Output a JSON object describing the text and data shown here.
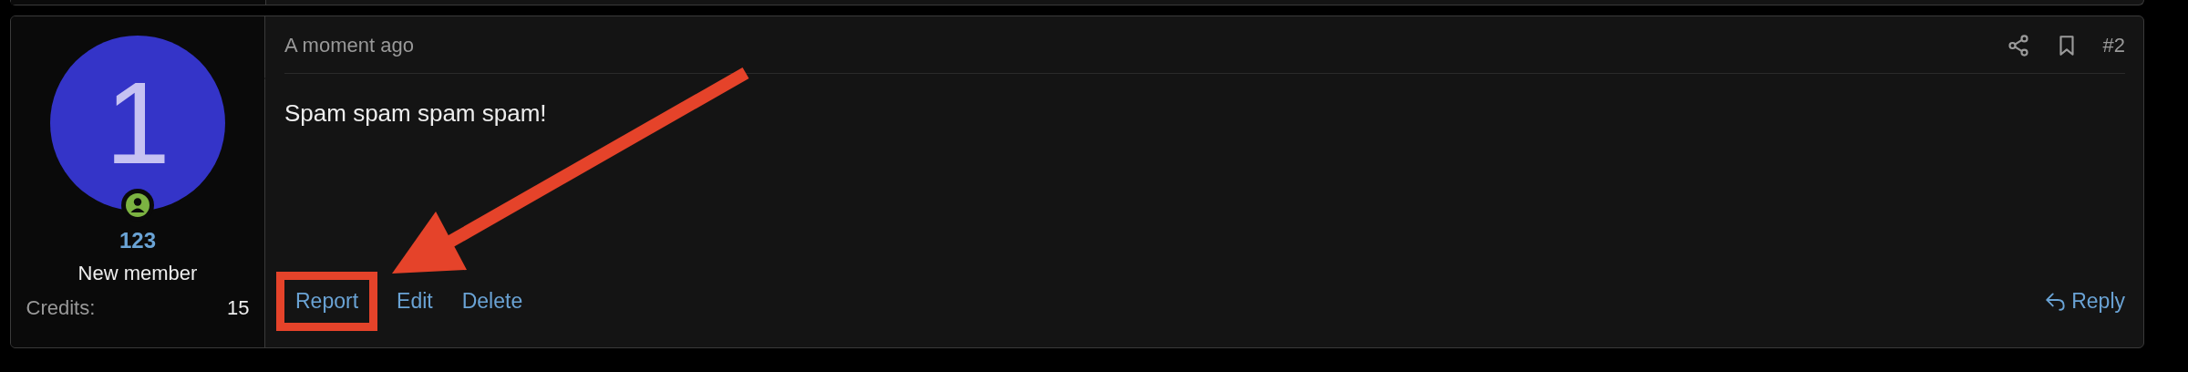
{
  "post": {
    "author": {
      "avatar_letter": "1",
      "name": "123",
      "title": "New member",
      "stats": [
        {
          "label": "Credits:",
          "value": "15"
        }
      ]
    },
    "time": "A moment ago",
    "number": "#2",
    "body": "Spam spam spam spam!",
    "actions": [
      {
        "label": "Report",
        "highlighted": true
      },
      {
        "label": "Edit",
        "highlighted": false
      },
      {
        "label": "Delete",
        "highlighted": false
      }
    ],
    "reply": "Reply"
  },
  "annotations": [
    {
      "kind": "arrow"
    }
  ]
}
